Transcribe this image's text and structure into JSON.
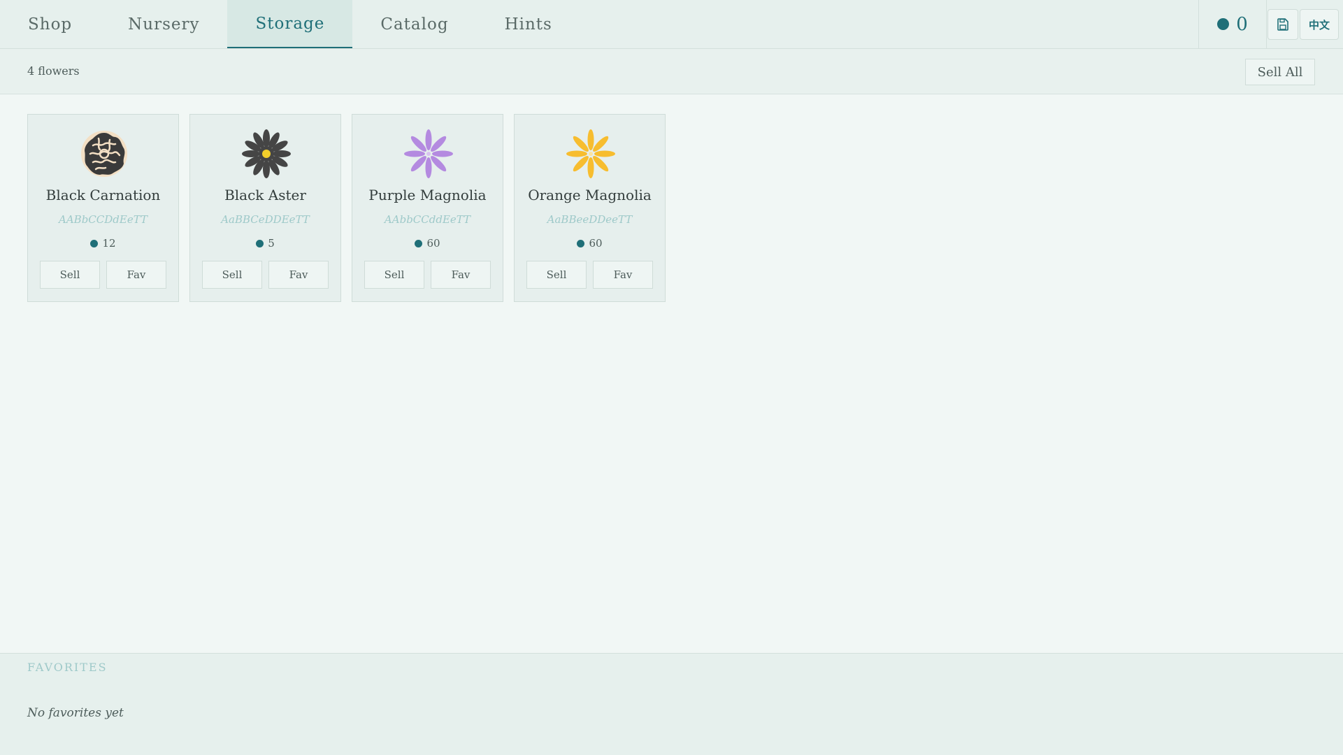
{
  "nav": {
    "tabs": [
      {
        "label": "Shop"
      },
      {
        "label": "Nursery"
      },
      {
        "label": "Storage"
      },
      {
        "label": "Catalog"
      },
      {
        "label": "Hints"
      }
    ],
    "active_tab": "Storage",
    "coins": "0",
    "save_icon": "save-icon",
    "language_label": "中文"
  },
  "storage": {
    "count_label": "4 flowers",
    "sell_all_label": "Sell All",
    "flowers": [
      {
        "name": "Black Carnation",
        "genes": "AABbCCDdEeTT",
        "price": "12",
        "sell_label": "Sell",
        "fav_label": "Fav"
      },
      {
        "name": "Black Aster",
        "genes": "AaBBCeDDEeTT",
        "price": "5",
        "sell_label": "Sell",
        "fav_label": "Fav"
      },
      {
        "name": "Purple Magnolia",
        "genes": "AAbbCCddEeTT",
        "price": "60",
        "sell_label": "Sell",
        "fav_label": "Fav"
      },
      {
        "name": "Orange Magnolia",
        "genes": "AaBBeeDDeeTT",
        "price": "60",
        "sell_label": "Sell",
        "fav_label": "Fav"
      }
    ]
  },
  "favorites": {
    "heading": "FAVORITES",
    "empty_text": "No favorites yet"
  },
  "colors": {
    "accent": "#1f6f78",
    "genes_text": "#9ec9c9",
    "carnation_petal": "#3a3a3a",
    "carnation_outline": "#f3dfc4",
    "aster_petal": "#454545",
    "aster_center": "#f4d02b",
    "purple_petal": "#b48ae0",
    "orange_petal": "#f7bd2f"
  }
}
